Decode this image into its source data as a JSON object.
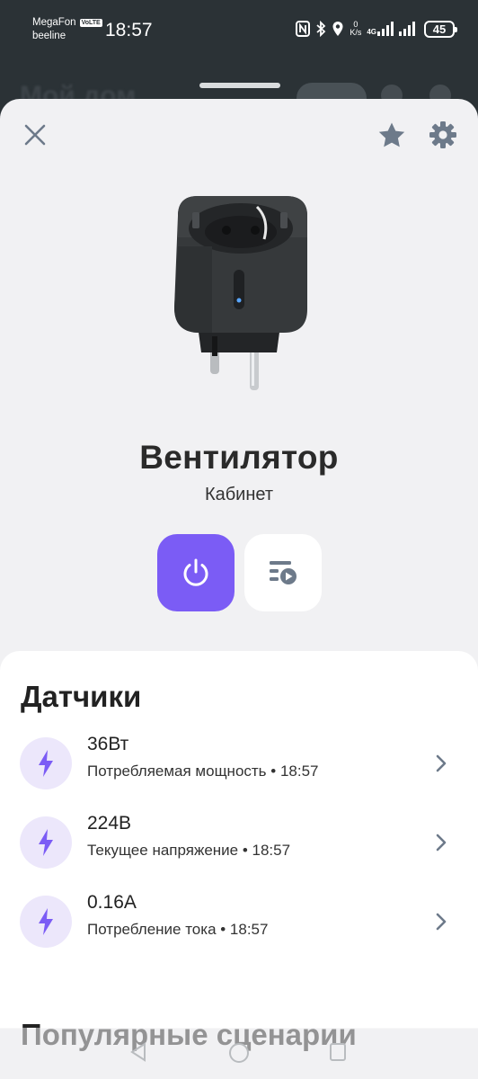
{
  "status_bar": {
    "carrier1": "MegaFon",
    "carrier1_badge": "VoLTE",
    "carrier2": "beeline",
    "time": "18:57",
    "net_speed_value": "0",
    "net_speed_unit": "K/s",
    "network_type": "4G",
    "battery": "45"
  },
  "background": {
    "title": "Мой дом"
  },
  "device": {
    "name": "Вентилятор",
    "room": "Кабинет"
  },
  "sensors": {
    "title": "Датчики",
    "items": [
      {
        "value": "36Вт",
        "label": "Потребляемая мощность • 18:57",
        "icon": "lightning-icon"
      },
      {
        "value": "224В",
        "label": "Текущее напряжение • 18:57",
        "icon": "lightning-icon"
      },
      {
        "value": "0.16А",
        "label": "Потребление тока • 18:57",
        "icon": "lightning-icon"
      }
    ]
  },
  "popular": {
    "title": "Популярные сценарии"
  },
  "colors": {
    "accent": "#7b5cf5",
    "icon_bg": "#ece7fb",
    "sheet_bg": "#f1f1f3",
    "status_bg": "#2b3236"
  }
}
